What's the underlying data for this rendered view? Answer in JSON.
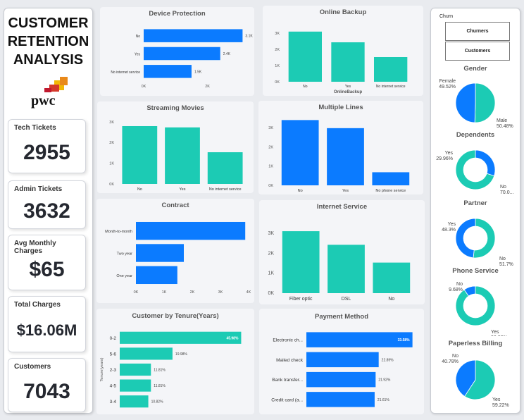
{
  "title": {
    "line1": "CUSTOMER",
    "line2": "RETENTION",
    "line3": "ANALYSIS",
    "logo_text": "pwc"
  },
  "kpis": [
    {
      "label": "Tech Tickets",
      "value": "2955"
    },
    {
      "label": "Admin Tickets",
      "value": "3632"
    },
    {
      "label": "Avg Monthly Charges",
      "value": "$65"
    },
    {
      "label": "Total Charges",
      "value": "$16.06M"
    },
    {
      "label": "Customers",
      "value": "7043"
    }
  ],
  "slicer": {
    "title": "Churn",
    "options": [
      "Churners",
      "Customers"
    ]
  },
  "colors": {
    "blue": "#0b7bff",
    "teal": "#1ccbb4",
    "accent_orange": "#e0781e"
  },
  "chart_data": [
    {
      "id": "device",
      "type": "bar",
      "orientation": "horizontal",
      "title": "Device Protection",
      "categories": [
        "No",
        "Yes",
        "No internet service"
      ],
      "values": [
        3100,
        2400,
        1500
      ],
      "data_labels": [
        "3.1K",
        "2.4K",
        "1.5K"
      ],
      "xlim": [
        0,
        3400
      ],
      "xticks": [
        0,
        2000
      ],
      "xtick_labels": [
        "0K",
        "2K"
      ],
      "color": "#0b7bff"
    },
    {
      "id": "backup",
      "type": "bar",
      "title": "Online Backup",
      "xlabel": "OnlineBackup",
      "categories": [
        "No",
        "Yes",
        "No internet service"
      ],
      "values": [
        3090,
        2430,
        1520
      ],
      "ylim": [
        0,
        3300
      ],
      "yticks": [
        0,
        1000,
        2000,
        3000
      ],
      "ytick_labels": [
        "0K",
        "1K",
        "2K",
        "3K"
      ],
      "color": "#1ccbb4"
    },
    {
      "id": "streaming",
      "type": "bar",
      "title": "Streaming Movies",
      "categories": [
        "No",
        "Yes",
        "No internet service"
      ],
      "values": [
        2790,
        2730,
        1530
      ],
      "ylim": [
        0,
        3300
      ],
      "yticks": [
        0,
        1000,
        2000,
        3000
      ],
      "ytick_labels": [
        "0K",
        "1K",
        "2K",
        "3K"
      ],
      "color": "#1ccbb4"
    },
    {
      "id": "multiple",
      "type": "bar",
      "title": "Multiple Lines",
      "categories": [
        "No",
        "Yes",
        "No phone service"
      ],
      "values": [
        3390,
        2970,
        680
      ],
      "ylim": [
        0,
        3550
      ],
      "yticks": [
        0,
        1000,
        2000,
        3000
      ],
      "ytick_labels": [
        "0K",
        "1K",
        "2K",
        "3K"
      ],
      "color": "#0b7bff"
    },
    {
      "id": "contract",
      "type": "bar",
      "orientation": "horizontal",
      "title": "Contract",
      "categories": [
        "Month-to-month",
        "Two year",
        "One year"
      ],
      "values": [
        3880,
        1700,
        1470
      ],
      "xlim": [
        0,
        4000
      ],
      "xticks": [
        0,
        1000,
        2000,
        3000,
        4000
      ],
      "xtick_labels": [
        "0K",
        "1K",
        "2K",
        "3K",
        "4K"
      ],
      "color": "#0b7bff"
    },
    {
      "id": "internet",
      "type": "bar",
      "title": "Internet Service",
      "categories": [
        "Fiber optic",
        "DSL",
        "No"
      ],
      "values": [
        3100,
        2420,
        1530
      ],
      "ylim": [
        0,
        3350
      ],
      "yticks": [
        0,
        1000,
        2000,
        3000
      ],
      "ytick_labels": [
        "0K",
        "1K",
        "2K",
        "3K"
      ],
      "color": "#1ccbb4"
    },
    {
      "id": "tenure",
      "type": "bar",
      "orientation": "horizontal",
      "title": "Customer by Tenure(Years)",
      "ylabel": "Tenure(years)",
      "categories": [
        "0-2",
        "5-6",
        "2-3",
        "4-5",
        "3-4"
      ],
      "values": [
        45.98,
        19.98,
        11.81,
        11.81,
        10.82
      ],
      "data_labels": [
        "45.98%",
        "19.98%",
        "11.81%",
        "11.81%",
        "10.82%"
      ],
      "xlim": [
        0,
        48
      ],
      "color": "#1ccbb4"
    },
    {
      "id": "payment",
      "type": "bar",
      "orientation": "horizontal",
      "title": "Payment Method",
      "categories": [
        "Electronic ch...",
        "Mailed check",
        "Bank transfer...",
        "Credit card (a..."
      ],
      "values": [
        33.58,
        22.89,
        21.92,
        21.61
      ],
      "data_labels": [
        "33.58%",
        "22.89%",
        "21.92%",
        "21.61%"
      ],
      "xlim": [
        0,
        35
      ],
      "color": "#0b7bff"
    },
    {
      "id": "gender",
      "type": "pie",
      "title": "Gender",
      "donut": false,
      "start_offset": 0,
      "labels": [
        "Male",
        "Female"
      ],
      "values": [
        50.48,
        49.52
      ],
      "value_labels": [
        "50.48%",
        "49.52%"
      ],
      "colors": [
        "#1ccbb4",
        "#0b7bff"
      ]
    },
    {
      "id": "dependents",
      "type": "pie",
      "title": "Dependents",
      "donut": true,
      "start_offset": 0,
      "labels": [
        "Yes",
        "No"
      ],
      "values": [
        29.96,
        70.04
      ],
      "value_labels": [
        "29.96%",
        "70.0..."
      ],
      "colors": [
        "#0b7bff",
        "#1ccbb4"
      ]
    },
    {
      "id": "partner",
      "type": "pie",
      "title": "Partner",
      "donut": true,
      "start_offset": 0,
      "labels": [
        "No",
        "Yes"
      ],
      "values": [
        51.7,
        48.3
      ],
      "value_labels": [
        "51.7%",
        "48.3%"
      ],
      "colors": [
        "#1ccbb4",
        "#0b7bff"
      ]
    },
    {
      "id": "phone",
      "type": "pie",
      "title": "Phone Service",
      "donut": true,
      "start_offset": -9.68,
      "labels": [
        "No",
        "Yes"
      ],
      "values": [
        9.68,
        90.32
      ],
      "value_labels": [
        "9.68%",
        "90.32%"
      ],
      "colors": [
        "#0b7bff",
        "#1ccbb4"
      ]
    },
    {
      "id": "paperless",
      "type": "pie",
      "title": "Paperless Billing",
      "donut": false,
      "start_offset": 0,
      "labels": [
        "Yes",
        "No"
      ],
      "values": [
        59.22,
        40.78
      ],
      "value_labels": [
        "59.22%",
        "40.78%"
      ],
      "colors": [
        "#1ccbb4",
        "#0b7bff"
      ]
    }
  ]
}
